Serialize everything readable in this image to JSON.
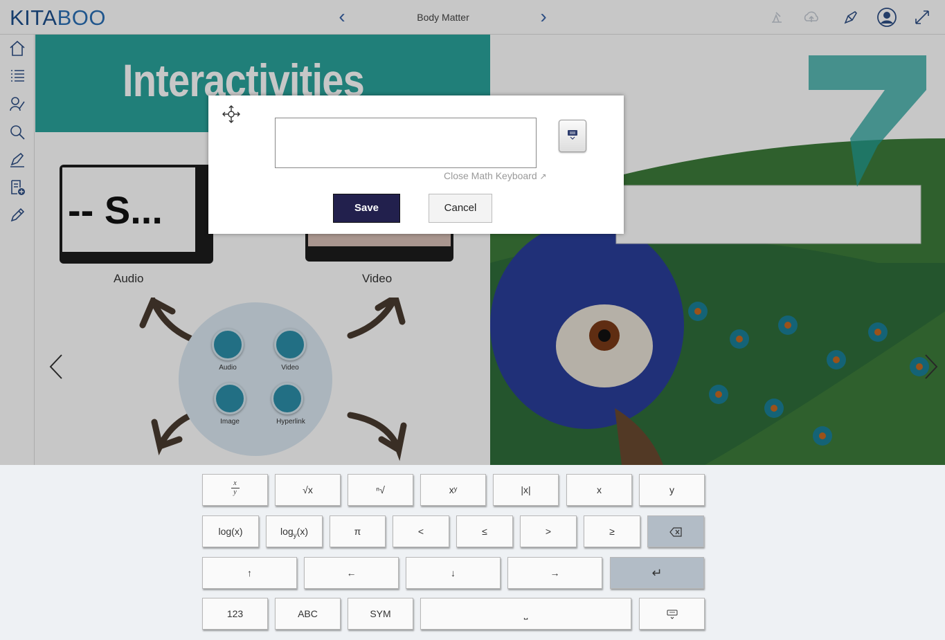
{
  "header": {
    "logo_left": "KITA",
    "logo_right": "BOO",
    "section_title": "Body Matter",
    "prev_label": "‹",
    "next_label": "›"
  },
  "page": {
    "banner_title": "Interactivities",
    "audio_device_text": "-- S...",
    "audio_caption": "Audio",
    "video_caption": "Video",
    "circle_items": [
      "Audio",
      "Video",
      "Image",
      "Hyperlink"
    ]
  },
  "dialog": {
    "input_value": "",
    "close_keyboard_label": "Close Math Keyboard",
    "save_label": "Save",
    "cancel_label": "Cancel"
  },
  "keyboard": {
    "row1": [
      "√x",
      "ⁿ√",
      "xʸ",
      "|x|",
      "x",
      "y"
    ],
    "row1_fraction_top": "x",
    "row1_fraction_bottom": "y",
    "row2": [
      "log(x)",
      "π",
      "<",
      "≤",
      ">",
      "≥"
    ],
    "row2_logy_base": "log",
    "row2_logy_sub": "y",
    "row2_logy_arg": "(x)",
    "row3": [
      "↑",
      "←",
      "↓",
      "→",
      "↵"
    ],
    "row4": [
      "123",
      "ABC",
      "SYM",
      "⎵"
    ]
  },
  "colors": {
    "accent_teal": "#2aa39c",
    "save_button": "#22204d",
    "icon_blue": "#3a64a8"
  }
}
